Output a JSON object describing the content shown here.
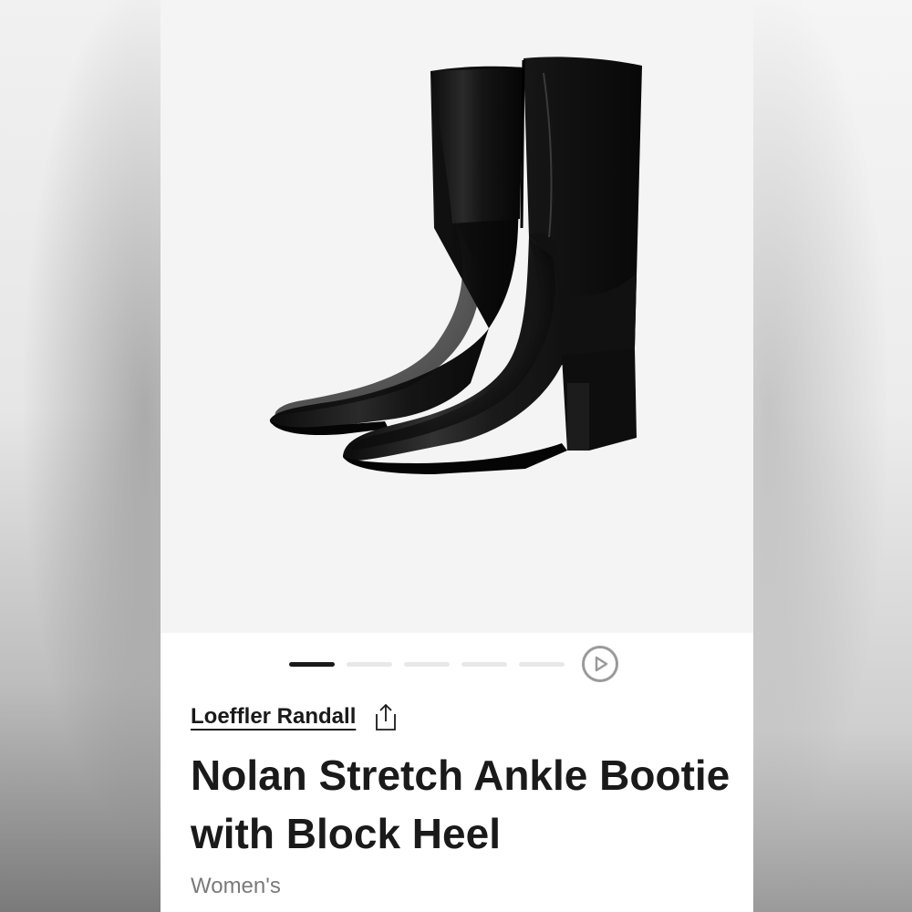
{
  "product": {
    "brand": "Loeffler Randall",
    "title": "Nolan Stretch Ankle Bootie with Block Heel",
    "category": "Women's"
  },
  "gallery": {
    "image_count": 5,
    "active_index": 0,
    "has_video": true
  },
  "icons": {
    "share": "share-icon",
    "play": "play-icon"
  },
  "colors": {
    "text": "#1a1a1a",
    "muted": "#7a7a7a",
    "image_bg": "#f4f4f4",
    "dot_inactive": "#e8e8e8",
    "dot_active": "#1a1a1a"
  }
}
